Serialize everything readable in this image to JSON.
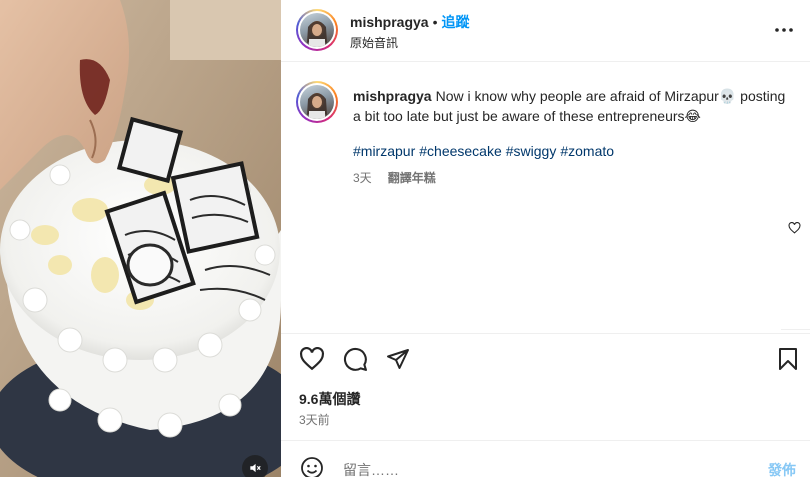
{
  "header": {
    "username": "mishpragya",
    "separator": "•",
    "follow_label": "追蹤",
    "audio_label": "原始音訊",
    "more_icon": "more-horizontal-icon"
  },
  "caption": {
    "username": "mishpragya",
    "text": "Now i know why people are afraid of Mirzapur💀 posting a bit too late but just be aware of these entrepreneurs😂",
    "hashtags": [
      "#mirzapur",
      "#cheesecake",
      "#swiggy",
      "#zomato"
    ],
    "age": "3天",
    "translate_label": "翻譯年糕"
  },
  "actions": {
    "like_icon": "heart-icon",
    "comment_icon": "comment-icon",
    "share_icon": "share-icon",
    "save_icon": "bookmark-icon"
  },
  "stats": {
    "likes": "9.6萬個讚",
    "posted": "3天前"
  },
  "comment_box": {
    "emoji_icon": "emoji-icon",
    "placeholder": "留言……",
    "post_label": "發佈"
  },
  "colors": {
    "accent": "#0095f6",
    "hashtag": "#00376b",
    "muted": "#737373",
    "post_disabled": "#87c8f5"
  }
}
